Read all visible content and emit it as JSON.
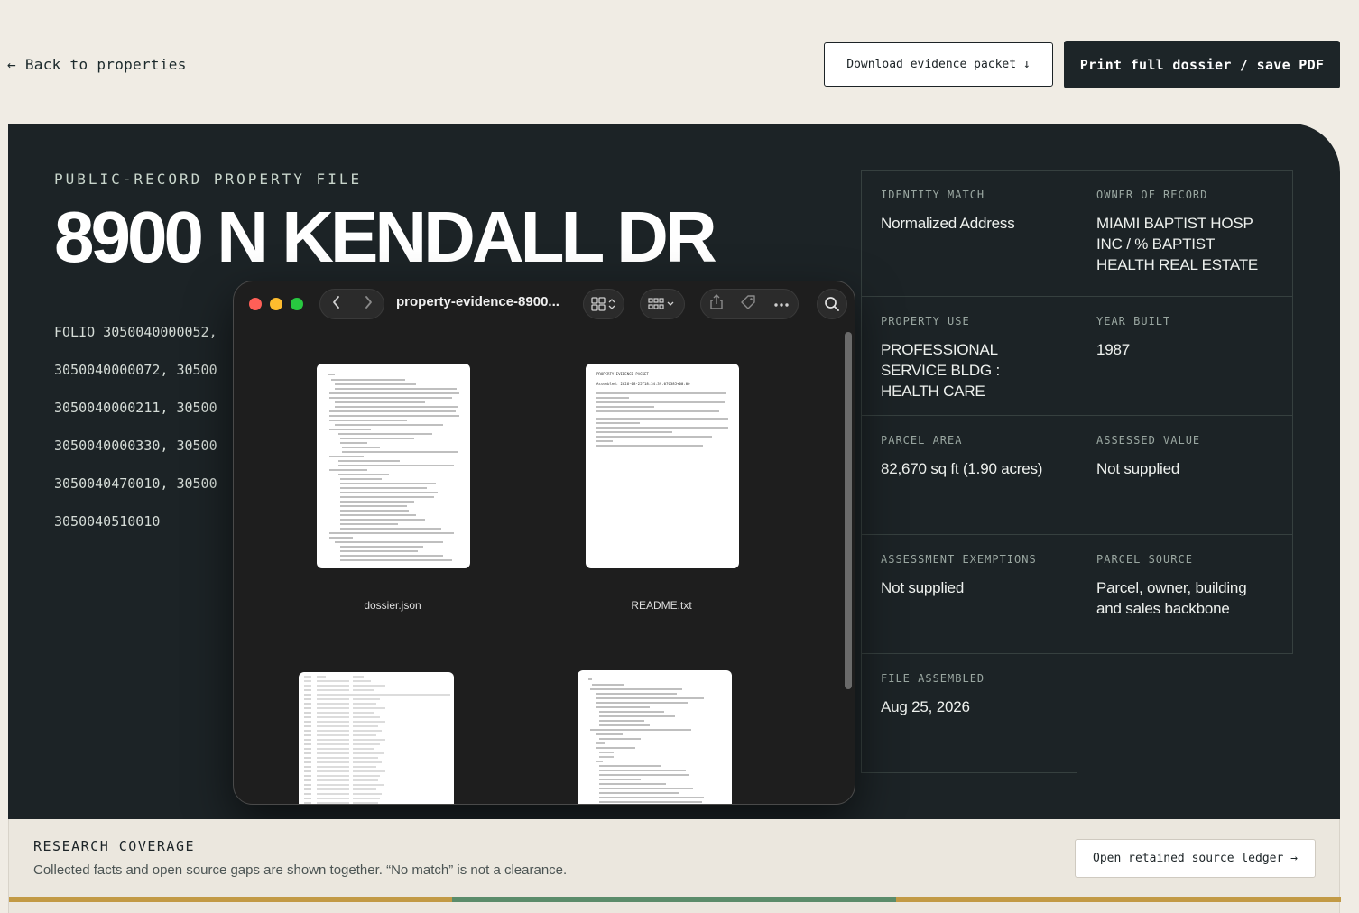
{
  "nav": {
    "back_label": "← Back to properties",
    "download_label": "Download evidence packet ↓",
    "print_label": "Print full dossier / save PDF"
  },
  "hero": {
    "eyebrow": "PUBLIC-RECORD PROPERTY FILE",
    "address": "8900 N KENDALL DR",
    "folio_lines": [
      "FOLIO 3050040000052,",
      "3050040000072, 30500",
      "3050040000211, 30500",
      "3050040000330, 30500",
      "3050040470010, 30500",
      "3050040510010"
    ]
  },
  "facts": [
    {
      "label": "IDENTITY MATCH",
      "value": "Normalized Address"
    },
    {
      "label": "OWNER OF RECORD",
      "value": "MIAMI BAPTIST HOSP INC / % BAPTIST HEALTH REAL ESTATE"
    },
    {
      "label": "PROPERTY USE",
      "value": "PROFESSIONAL SERVICE BLDG : HEALTH CARE"
    },
    {
      "label": "YEAR BUILT",
      "value": "1987"
    },
    {
      "label": "PARCEL AREA",
      "value": "82,670 sq ft (1.90 acres)"
    },
    {
      "label": "ASSESSED VALUE",
      "value": "Not supplied"
    },
    {
      "label": "ASSESSMENT EXEMPTIONS",
      "value": "Not supplied"
    },
    {
      "label": "PARCEL SOURCE",
      "value": "Parcel, owner, building and sales backbone"
    },
    {
      "label": "FILE ASSEMBLED",
      "value": "Aug 25, 2026"
    }
  ],
  "finder": {
    "title": "property-evidence-8900...",
    "icons": [
      "back-chevron-icon",
      "forward-chevron-icon",
      "grid-view-icon",
      "group-icon",
      "share-icon",
      "tag-icon",
      "more-icon",
      "search-icon"
    ],
    "files": [
      {
        "name": "dossier.json"
      },
      {
        "name": "README.txt"
      },
      {
        "name": ""
      },
      {
        "name": ""
      }
    ],
    "readme_preview": {
      "heading": "PROPERTY EVIDENCE PACKET",
      "assembled": "Assembled: 2026-08-25T18:34:39.076385+00:00"
    }
  },
  "coverage": {
    "title": "RESEARCH COVERAGE",
    "subtitle": "Collected facts and open source gaps are shown together. “No match” is not a clearance.",
    "ledger_label": "Open retained source ledger →",
    "bar_colors": [
      "#c29a45",
      "#5b8c6a",
      "#c29a45"
    ]
  },
  "colors": {
    "page_bg": "#f0ece4",
    "hero_bg": "#1c2326",
    "accent_gold": "#c29a45",
    "accent_green": "#5b8c6a"
  }
}
